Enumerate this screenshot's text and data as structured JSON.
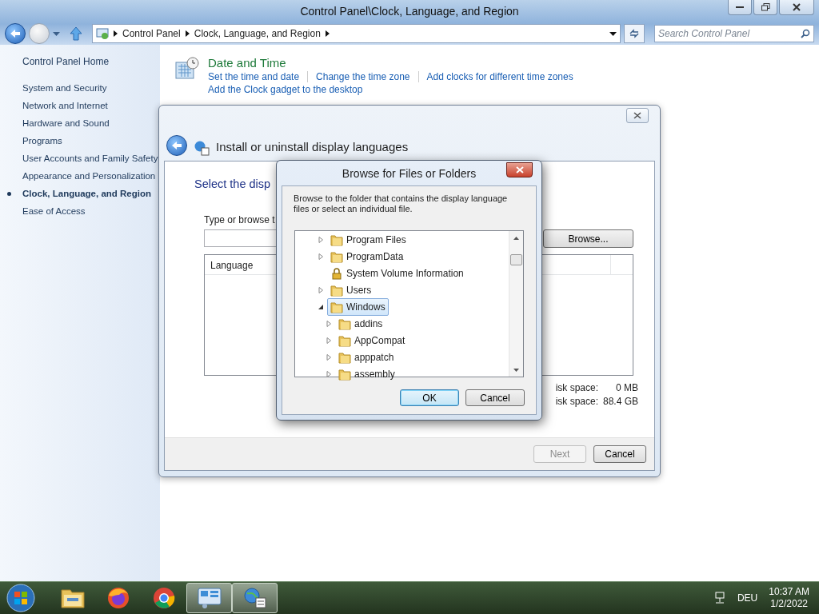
{
  "window": {
    "title": "Control Panel\\Clock, Language, and Region"
  },
  "address_bar": {
    "breadcrumbs": [
      "Control Panel",
      "Clock, Language, and Region"
    ],
    "search_placeholder": "Search Control Panel"
  },
  "sidebar": {
    "home": "Control Panel Home",
    "items": [
      {
        "label": "System and Security",
        "selected": false
      },
      {
        "label": "Network and Internet",
        "selected": false
      },
      {
        "label": "Hardware and Sound",
        "selected": false
      },
      {
        "label": "Programs",
        "selected": false
      },
      {
        "label": "User Accounts and Family Safety",
        "selected": false
      },
      {
        "label": "Appearance and Personalization",
        "selected": false
      },
      {
        "label": "Clock, Language, and Region",
        "selected": true
      },
      {
        "label": "Ease of Access",
        "selected": false
      }
    ]
  },
  "category": {
    "title": "Date and Time",
    "links": [
      "Set the time and date",
      "Change the time zone",
      "Add clocks for different time zones",
      "Add the Clock gadget to the desktop"
    ]
  },
  "wizard": {
    "title": "Install or uninstall display languages",
    "heading": "Select the disp",
    "field_label": "Type or browse t",
    "browse_button": "Browse...",
    "list_columns": [
      "Language"
    ],
    "disk_space": [
      {
        "label": "isk space:",
        "value": "0 MB"
      },
      {
        "label": "isk space:",
        "value": "88.4 GB"
      }
    ],
    "buttons": [
      {
        "label": "Next",
        "disabled": true
      },
      {
        "label": "Cancel",
        "disabled": false
      }
    ]
  },
  "dialog": {
    "title": "Browse for Files or Folders",
    "description": "Browse to the folder that contains the display language files or select an individual file.",
    "tree": [
      {
        "label": "Program Files",
        "kind": "folder",
        "expanded": false,
        "selected": false
      },
      {
        "label": "ProgramData",
        "kind": "folder",
        "expanded": false,
        "selected": false
      },
      {
        "label": "System Volume Information",
        "kind": "locked",
        "selected": false
      },
      {
        "label": "Users",
        "kind": "folder",
        "expanded": false,
        "selected": false
      },
      {
        "label": "Windows",
        "kind": "folder",
        "expanded": true,
        "selected": true,
        "children": [
          {
            "label": "addins",
            "kind": "folder",
            "expanded": false,
            "selected": false
          },
          {
            "label": "AppCompat",
            "kind": "folder",
            "expanded": false,
            "selected": false
          },
          {
            "label": "apppatch",
            "kind": "folder",
            "expanded": false,
            "selected": false
          },
          {
            "label": "assembly",
            "kind": "folder",
            "expanded": false,
            "selected": false
          }
        ]
      }
    ],
    "buttons": [
      {
        "label": "OK",
        "default": true
      },
      {
        "label": "Cancel",
        "default": false
      }
    ]
  },
  "taskbar": {
    "apps": [
      {
        "kind": "explorer",
        "active": false
      },
      {
        "kind": "firefox",
        "active": false
      },
      {
        "kind": "chrome",
        "active": false
      },
      {
        "kind": "control-panel",
        "active": true
      },
      {
        "kind": "language-setup",
        "active": true
      }
    ],
    "language": "DEU",
    "time": "10:37 AM",
    "date": "1/2/2022"
  }
}
